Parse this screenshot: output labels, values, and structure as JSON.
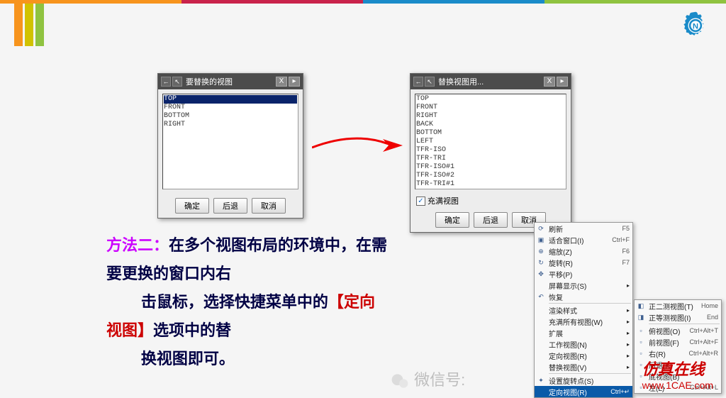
{
  "dialog1": {
    "title": "要替换的视图",
    "items": [
      "TOP",
      "FRONT",
      "BOTTOM",
      "RIGHT"
    ],
    "selected": "TOP",
    "buttons": {
      "ok": "确定",
      "back": "后退",
      "cancel": "取消"
    }
  },
  "dialog2": {
    "title": "替换视图用...",
    "items": [
      "TOP",
      "FRONT",
      "RIGHT",
      "BACK",
      "BOTTOM",
      "LEFT",
      "TFR-ISO",
      "TFR-TRI",
      "TFR-ISO#1",
      "TFR-ISO#2",
      "TFR-TRI#1"
    ],
    "checkbox_label": "充满视图",
    "buttons": {
      "ok": "确定",
      "back": "后退",
      "cancel": "取消"
    }
  },
  "body": {
    "prefix_label": "方法二：",
    "line1a": "在多个视图布局的环境中，在需",
    "line2": "要更换的窗口内右",
    "line3a": "击鼠标，选择快捷菜单中的",
    "bracket_open": "【",
    "orient": "定向",
    "line4a": "视图",
    "bracket_close": "】",
    "line4b": "选项中的替",
    "line5": "换视图即可。"
  },
  "menu1": {
    "items": [
      {
        "label": "刷新",
        "shortcut": "F5"
      },
      {
        "label": "适合窗口(I)",
        "shortcut": "Ctrl+F"
      },
      {
        "label": "缩放(Z)",
        "shortcut": "F6"
      },
      {
        "label": "旋转(R)",
        "shortcut": "F7"
      },
      {
        "label": "平移(P)",
        "shortcut": ""
      },
      {
        "label": "屏幕显示(S)",
        "shortcut": "",
        "sub": true
      },
      {
        "label": "恢复",
        "shortcut": ""
      }
    ],
    "group2": [
      {
        "label": "渲染样式",
        "sub": true
      },
      {
        "label": "充满所有视图(W)",
        "sub": true
      },
      {
        "label": "扩展",
        "sub": true
      },
      {
        "label": "工作视图(N)",
        "sub": true
      },
      {
        "label": "定向视图(R)",
        "sub": true
      },
      {
        "label": "替换视图(V)",
        "sub": true
      },
      {
        "label": "设置旋转点(S)"
      }
    ]
  },
  "menu2": {
    "items": [
      {
        "label": "正二测视图(T)",
        "shortcut": "Home"
      },
      {
        "label": "正等测视图(I)",
        "shortcut": "End"
      },
      {
        "sep": true
      },
      {
        "label": "俯视图(O)",
        "shortcut": "Ctrl+Alt+T"
      },
      {
        "label": "前视图(F)",
        "shortcut": "Ctrl+Alt+F"
      },
      {
        "label": "右(R)",
        "shortcut": "Ctrl+Alt+R"
      },
      {
        "label": "后退(K)",
        "shortcut": ""
      },
      {
        "label": "底视图(B)",
        "shortcut": ""
      },
      {
        "label": "左(L)",
        "shortcut": "Ctrl+Alt+L"
      }
    ],
    "sel_label": "定向视图(R)"
  },
  "footer": {
    "brand": "仿真在线",
    "domain": "www.1CAE.com"
  },
  "wechat_label": "微信号:"
}
